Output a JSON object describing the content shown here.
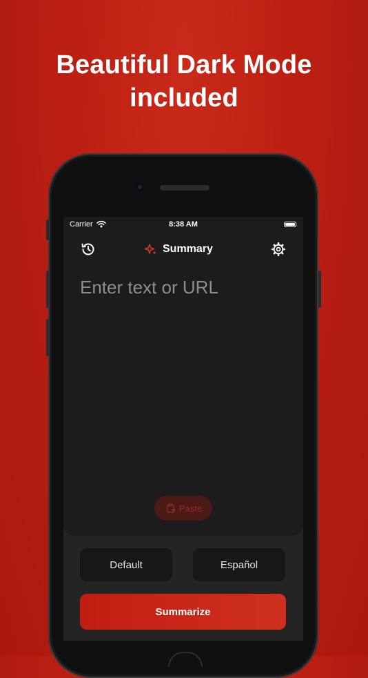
{
  "marketing": {
    "headline_line1": "Beautiful Dark Mode",
    "headline_line2": "included"
  },
  "status_bar": {
    "carrier": "Carrier",
    "time": "8:38 AM"
  },
  "nav": {
    "title": "Summary",
    "left_icon": "history-icon",
    "title_icon": "sparkles-icon",
    "right_icon": "gear-icon"
  },
  "input": {
    "value": "",
    "placeholder": "Enter text or URL"
  },
  "paste_button": {
    "label": "Paste",
    "icon": "clipboard-icon"
  },
  "options": {
    "style_label": "Default",
    "language_label": "Español"
  },
  "summarize_button": {
    "label": "Summarize"
  },
  "colors": {
    "background": "#bb1f12",
    "accent": "#d0301f",
    "screen_bg": "#1c1c1c",
    "panel_bg": "#242424"
  }
}
